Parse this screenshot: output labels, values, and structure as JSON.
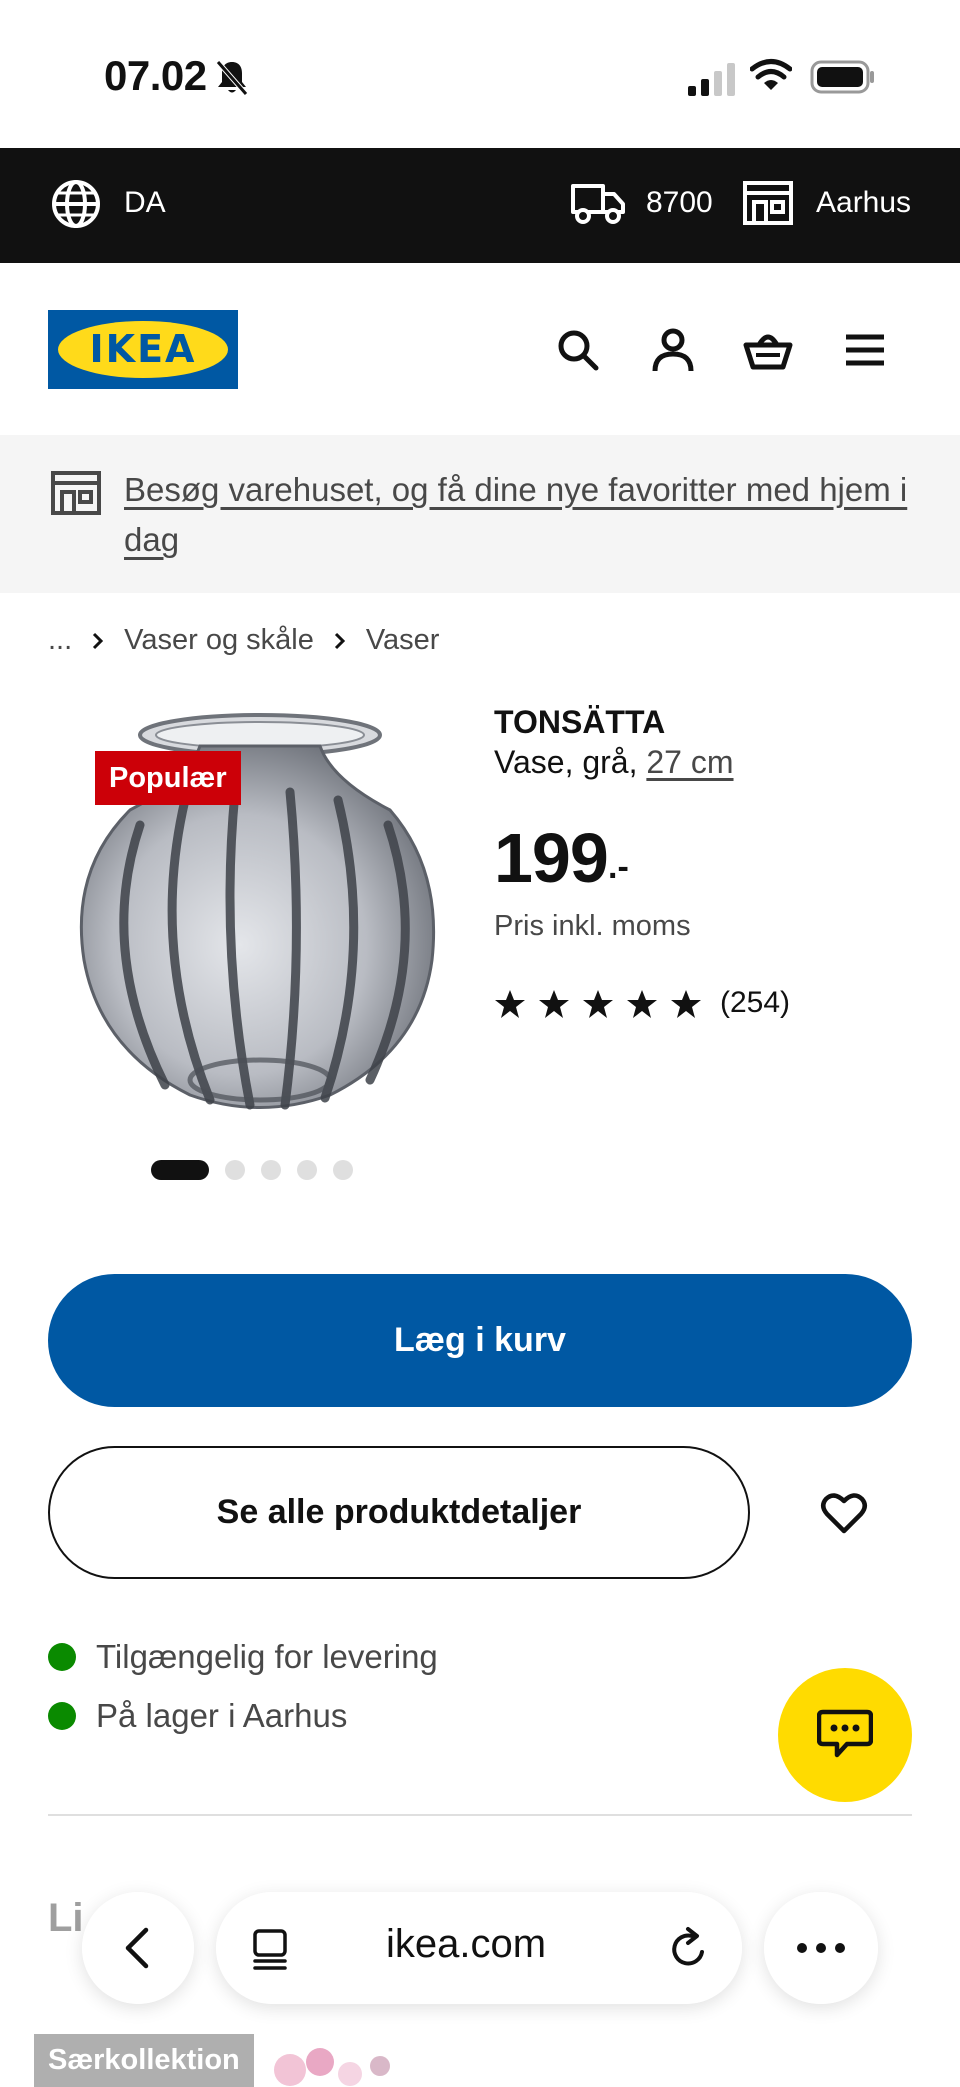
{
  "status_bar": {
    "time": "07.02"
  },
  "topbar": {
    "language": "DA",
    "postal_code": "8700",
    "store": "Aarhus"
  },
  "header": {
    "logo_text": "IKEA"
  },
  "banner": {
    "text": "Besøg varehuset, og få dine nye favoritter med hjem i dag"
  },
  "breadcrumb": {
    "ellipsis": "...",
    "items": [
      "Vaser og skåle",
      "Vaser"
    ]
  },
  "product": {
    "badge": "Populær",
    "name": "TONSÄTTA",
    "desc_prefix": "Vase, grå, ",
    "size": "27 cm",
    "price": "199",
    "price_suffix": ".-",
    "price_note": "Pris inkl. moms",
    "rating": 5,
    "review_count": "(254)",
    "image_count": 5,
    "active_image": 1
  },
  "buttons": {
    "add_to_cart": "Læg i kurv",
    "details": "Se alle produktdetaljer"
  },
  "availability": [
    "Tilgængelig for levering",
    "På lager i Aarhus"
  ],
  "colors": {
    "brand_blue": "#0058a3",
    "brand_yellow": "#ffdb00",
    "sale_red": "#cc0008",
    "stock_green": "#0a8a00"
  },
  "section": {
    "partial_title": "Li"
  },
  "browser": {
    "url": "ikea.com"
  },
  "bottom": {
    "badge": "Særkollektion"
  }
}
